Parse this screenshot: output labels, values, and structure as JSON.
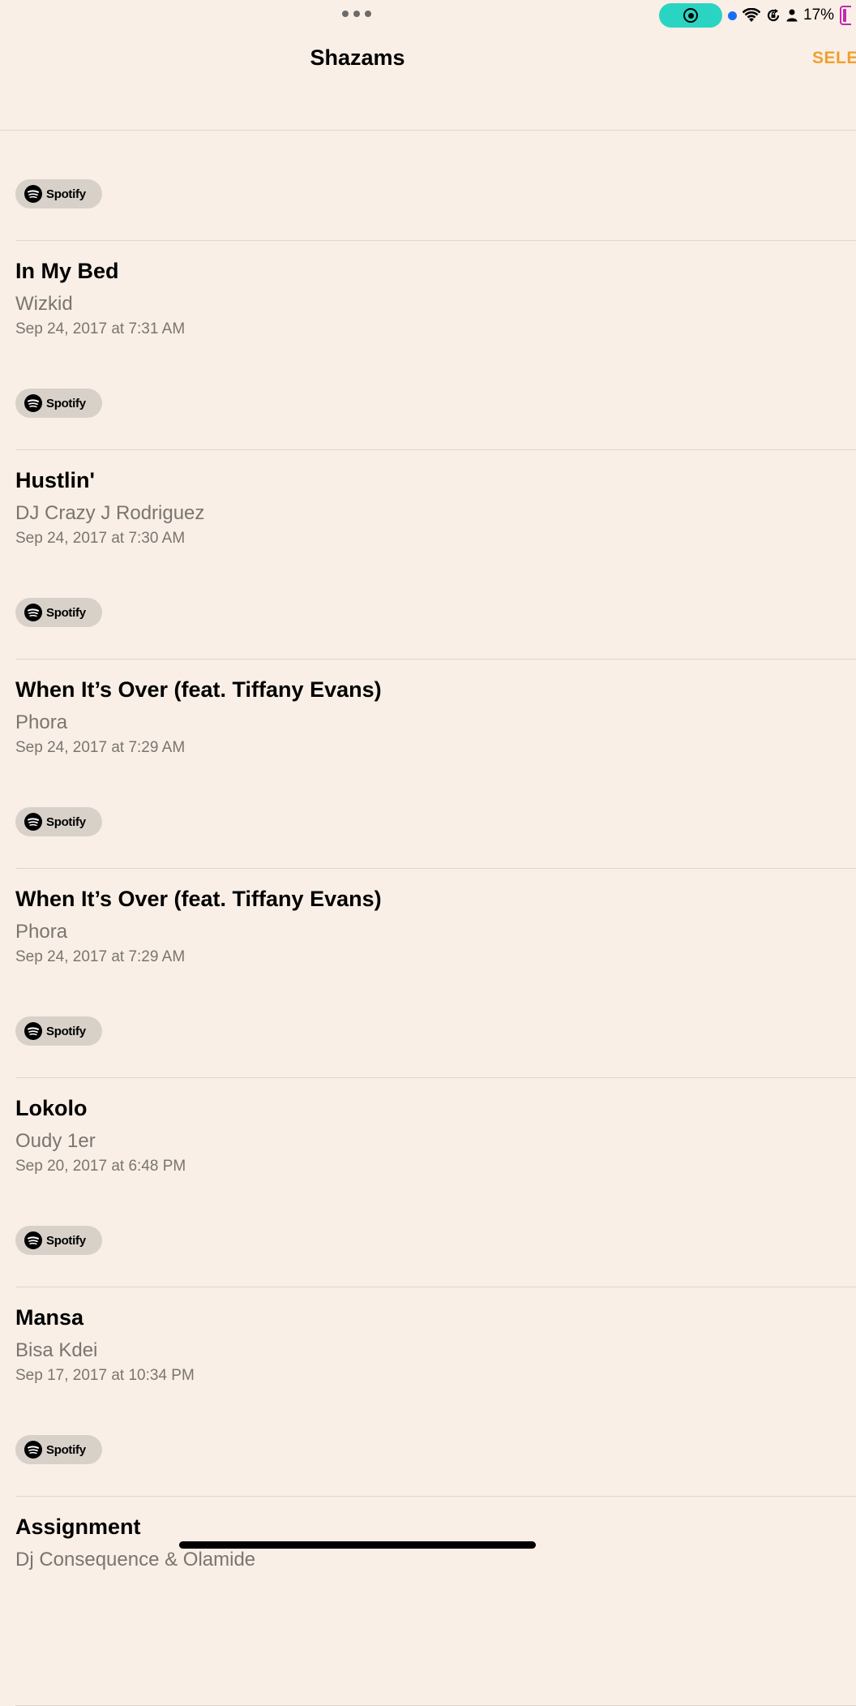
{
  "status_bar": {
    "battery": "17%",
    "colors": {
      "record_pill": "#2ad4c2",
      "location_dot": "#1a6ef5",
      "battery": "#c02ab0"
    }
  },
  "nav": {
    "title": "Shazams",
    "select_label": "SELE",
    "accent_color": "#f0a030"
  },
  "first_row": {
    "spotify_label": "Spotify"
  },
  "songs": [
    {
      "title": "In My Bed",
      "artist": "Wizkid",
      "date": "Sep 24, 2017 at 7:31 AM",
      "spotify_label": "Spotify"
    },
    {
      "title": "Hustlin'",
      "artist": "DJ Crazy J Rodriguez",
      "date": "Sep 24, 2017 at 7:30 AM",
      "spotify_label": "Spotify"
    },
    {
      "title": "When It’s Over (feat. Tiffany Evans)",
      "artist": "Phora",
      "date": "Sep 24, 2017 at 7:29 AM",
      "spotify_label": "Spotify"
    },
    {
      "title": "When It’s Over (feat. Tiffany Evans)",
      "artist": "Phora",
      "date": "Sep 24, 2017 at 7:29 AM",
      "spotify_label": "Spotify"
    },
    {
      "title": "Lokolo",
      "artist": "Oudy 1er",
      "date": "Sep 20, 2017 at 6:48 PM",
      "spotify_label": "Spotify"
    },
    {
      "title": "Mansa",
      "artist": "Bisa Kdei",
      "date": "Sep 17, 2017 at 10:34 PM",
      "spotify_label": "Spotify"
    },
    {
      "title": "Assignment",
      "artist": "Dj Consequence & Olamide",
      "date": "",
      "spotify_label": ""
    }
  ]
}
